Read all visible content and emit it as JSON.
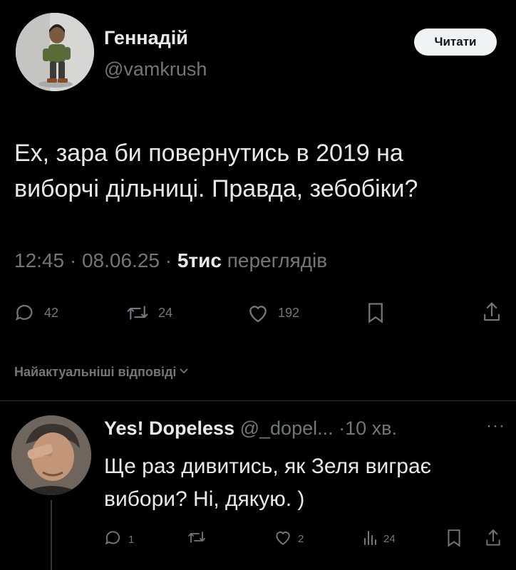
{
  "tweet": {
    "author_name": "Геннадій",
    "author_handle": "@vamkrush",
    "follow_label": "Читати",
    "text_line1": "Ех, зара би повернутись в 2019 на",
    "text_line2": "виборчі дільниці. Правда, зебобіки?",
    "time": "12:45",
    "date": "08.06.25",
    "views_count": "5тис",
    "views_label": "переглядів",
    "actions": {
      "replies": "42",
      "reposts": "24",
      "likes": "192"
    }
  },
  "replies_section": {
    "label": "Найактуальніші відповіді"
  },
  "reply": {
    "author_name": "Yes! Dopeless",
    "author_handle": "@_dopel...",
    "time": "10 хв.",
    "text_line1": "Ще раз дивитись, як Зеля виграє",
    "text_line2": "вибори? Ні, дякую. )",
    "actions": {
      "replies": "1",
      "likes": "2",
      "views": "24"
    }
  },
  "icons": {
    "reply": "reply-icon",
    "repost": "repost-icon",
    "like": "like-icon",
    "bookmark": "bookmark-icon",
    "share": "share-icon",
    "views": "views-icon",
    "more": "more-icon",
    "chevron": "chevron-down-icon"
  },
  "colors": {
    "background": "#000000",
    "text": "#e7e9ea",
    "muted": "#71767b",
    "divider": "#2f3336",
    "button_bg": "#eff3f4"
  }
}
